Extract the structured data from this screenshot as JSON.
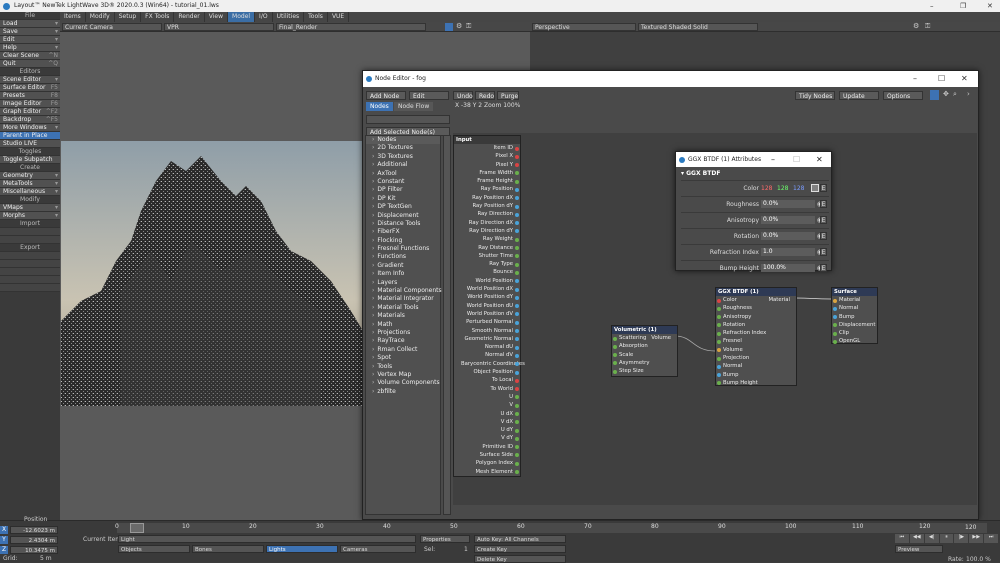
{
  "window": {
    "title": "Layout™ NewTek LightWave 3D® 2020.0.3 (Win64) - tutorial_01.lws"
  },
  "menu": [
    "Items",
    "Modify",
    "Setup",
    "FX Tools",
    "Render",
    "View",
    "Model",
    "I/O",
    "Utilities",
    "Tools",
    "VUE"
  ],
  "sidebar": [
    {
      "t": "File",
      "c": "hdr"
    },
    {
      "t": "Load",
      "k": "▾"
    },
    {
      "t": "Save",
      "k": "▾"
    },
    {
      "t": "Edit",
      "k": "▾"
    },
    {
      "t": "Help",
      "k": "▾"
    },
    {
      "t": "Clear Scene",
      "k": "^N"
    },
    {
      "t": "Quit",
      "k": "^Q"
    },
    {
      "t": "Editors",
      "c": "hdr"
    },
    {
      "t": "Scene Editor",
      "k": "▾"
    },
    {
      "t": "Surface Editor",
      "k": "F5"
    },
    {
      "t": "Presets",
      "k": "F8"
    },
    {
      "t": "Image Editor",
      "k": "F6"
    },
    {
      "t": "Graph Editor",
      "k": "^F2"
    },
    {
      "t": "Backdrop",
      "k": "^F5"
    },
    {
      "t": "More Windows",
      "k": "▾"
    },
    {
      "t": "Parent in Place",
      "c": "sel"
    },
    {
      "t": "Studio LIVE"
    },
    {
      "t": "Toggles",
      "c": "hdr"
    },
    {
      "t": "Toggle Subpatch"
    },
    {
      "t": "Create",
      "c": "hdr"
    },
    {
      "t": "Geometry",
      "k": "▾"
    },
    {
      "t": "MetaTools",
      "k": "▾"
    },
    {
      "t": "Miscellaneous",
      "k": "▾"
    },
    {
      "t": "Modify",
      "c": "hdr"
    },
    {
      "t": "VMaps",
      "k": "▾"
    },
    {
      "t": "Morphs",
      "k": "▾"
    },
    {
      "t": "Import",
      "c": "hdr"
    },
    {
      "t": "",
      "c": "dis"
    },
    {
      "t": "",
      "c": "dis"
    },
    {
      "t": "Export",
      "c": "hdr"
    },
    {
      "t": "",
      "c": "dis"
    },
    {
      "t": "",
      "c": "dis"
    },
    {
      "t": "",
      "c": "dis"
    },
    {
      "t": "",
      "c": "dis"
    },
    {
      "t": "",
      "c": "dis"
    }
  ],
  "viewport_left": {
    "camera": "Current Camera",
    "mode": "VPR",
    "render": "Final_Render"
  },
  "viewport_right": {
    "view": "Perspective",
    "shading": "Textured Shaded Solid"
  },
  "node_editor": {
    "title": "Node Editor - fog",
    "menu": [
      "Add Node",
      "Edit",
      "Undo",
      "Redo",
      "Purge",
      "Tidy Nodes",
      "Update",
      "Options"
    ],
    "tabs": [
      "Nodes",
      "Node Flow"
    ],
    "coords": "X -38 Y 2 Zoom 100%",
    "add_selected": "Add Selected Node(s)",
    "list_header": "Nodes",
    "categories": [
      "2D Textures",
      "3D Textures",
      "Additional",
      "AxTool",
      "Constant",
      "DP Filter",
      "DP Kit",
      "DP TextGen",
      "Displacement",
      "Distance Tools",
      "FiberFX",
      "Flocking",
      "Fresnel Functions",
      "Functions",
      "Gradient",
      "Item Info",
      "Layers",
      "Material Components",
      "Material Integrator",
      "Material Tools",
      "Materials",
      "Math",
      "Projections",
      "RayTrace",
      "Rman Collect",
      "Spot",
      "Tools",
      "Vertex Map",
      "Volume Components",
      "zbfilte"
    ],
    "input_node": {
      "title": "Input",
      "ports": [
        "Item ID",
        "Pixel X",
        "Pixel Y",
        "Frame Width",
        "Frame Height",
        "Ray Position",
        "Ray Position dX",
        "Ray Position dY",
        "Ray Direction",
        "Ray Direction dX",
        "Ray Direction dY",
        "Ray Weight",
        "Ray Distance",
        "Shutter Time",
        "Ray Type",
        "Bounce",
        "World Position",
        "World Position dX",
        "World Position dY",
        "World Position dU",
        "World Position dV",
        "Perturbed Normal",
        "Smooth Normal",
        "Geometric Normal",
        "Normal dU",
        "Normal dV",
        "Barycentric Coordinates",
        "Object Position",
        "To Local",
        "To World",
        "U",
        "V",
        "U dX",
        "V dX",
        "U dY",
        "V dY",
        "Primitive ID",
        "Surface Side",
        "Polygon Index",
        "Mesh Element"
      ]
    },
    "volumetric_node": {
      "title": "Volumetric (1)",
      "output": "Volume",
      "ports": [
        "Scattering",
        "Absorption",
        "Scale",
        "Asymmetry",
        "Step Size"
      ]
    },
    "ggx_node": {
      "title": "GGX BTDF (1)",
      "output": "Material",
      "ports": [
        "Color",
        "Roughness",
        "Anisotropy",
        "Rotation",
        "Refraction Index",
        "Fresnel",
        "Volume",
        "Projection",
        "Normal",
        "Bump",
        "Bump Height"
      ]
    },
    "surface_node": {
      "title": "Surface",
      "ports": [
        "Material",
        "Normal",
        "Bump",
        "Displacement",
        "Clip",
        "OpenGL"
      ]
    }
  },
  "attributes": {
    "title": "GGX BTDF (1) Attributes",
    "section": "GGX BTDF",
    "rows": [
      {
        "label": "Color",
        "value": "",
        "rgb": [
          "128",
          "128",
          "128"
        ]
      },
      {
        "label": "Roughness",
        "value": "0.0%"
      },
      {
        "label": "Anisotropy",
        "value": "0.0%"
      },
      {
        "label": "Rotation",
        "value": "0.0%"
      },
      {
        "label": "Refraction Index",
        "value": "1.0"
      },
      {
        "label": "Bump Height",
        "value": "100.0%"
      }
    ]
  },
  "timeline": {
    "ticks": [
      "0",
      "10",
      "20",
      "30",
      "40",
      "50",
      "60",
      "70",
      "80",
      "90",
      "100",
      "110",
      "120"
    ],
    "end": "120"
  },
  "bottom": {
    "position_label": "Position",
    "x": "-12.6023 m",
    "y": "2.4304 m",
    "z": "10.3475 m",
    "grid_label": "Grid:",
    "grid": "5 m",
    "current_item_label": "Current Item",
    "current_item": "Light",
    "objects": "Objects",
    "bones": "Bones",
    "lights": "Lights",
    "cameras": "Cameras",
    "properties": "Properties",
    "sel_label": "Sel:",
    "sel": "1",
    "autokey": "Auto Key: All Channels",
    "create_key": "Create Key",
    "delete_key": "Delete Key",
    "preview": "Preview",
    "rate_label": "Rate:",
    "rate": "100.0 %"
  },
  "colors": {
    "accent": "#3d72b3",
    "panel": "#4a4a4a"
  }
}
